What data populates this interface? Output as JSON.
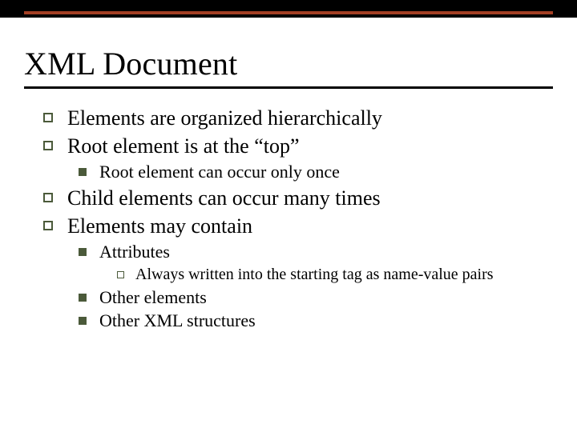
{
  "title": "XML Document",
  "bullets": {
    "l1_0": "Elements are organized hierarchically",
    "l1_1": "Root element is at the “top”",
    "l2_0": "Root element can occur only once",
    "l1_2": "Child elements can occur many times",
    "l1_3": "Elements may contain",
    "l2_1": "Attributes",
    "l3_0": "Always written into the starting tag as name-value pairs",
    "l2_2": "Other elements",
    "l2_3": "Other XML structures"
  }
}
